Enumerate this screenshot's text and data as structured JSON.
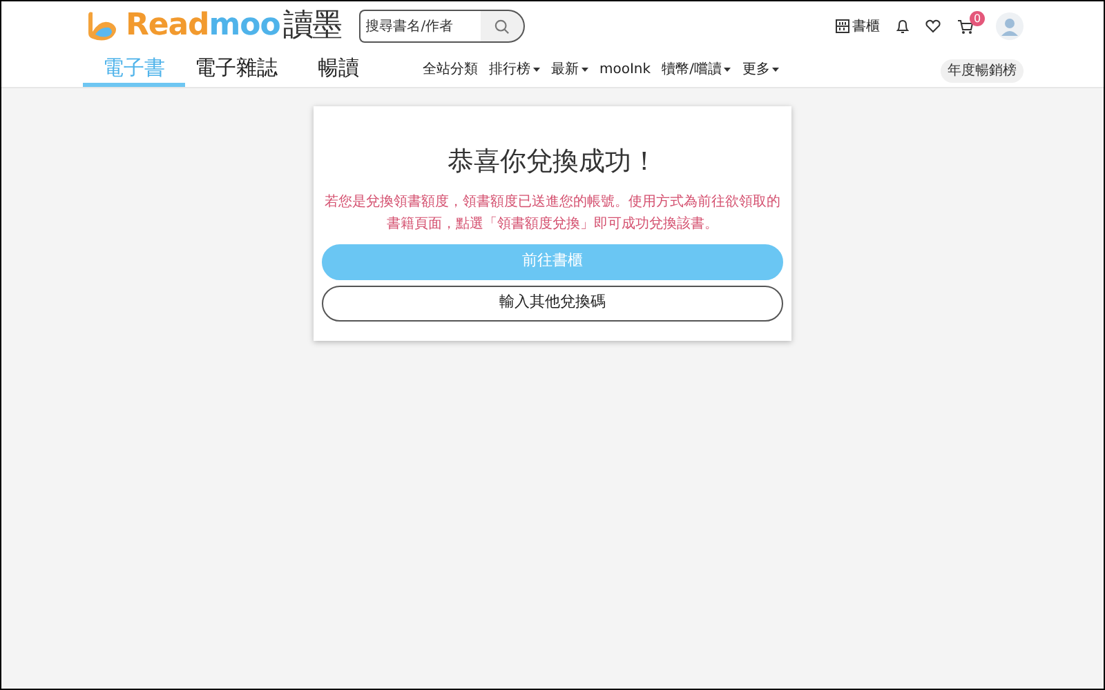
{
  "header": {
    "logo": {
      "part_1": "Read",
      "part_2": "moo",
      "chinese": "讀墨"
    },
    "search": {
      "placeholder": "搜尋書名/作者"
    },
    "bookshelf_label": "書櫃",
    "cart_count": "0"
  },
  "tabs": [
    {
      "label": "電子書",
      "selected": true
    },
    {
      "label": "電子雜誌",
      "selected": false
    },
    {
      "label": "暢讀",
      "selected": false
    }
  ],
  "nav_links": [
    {
      "label": "全站分類",
      "has_menu": false
    },
    {
      "label": "排行榜",
      "has_menu": true
    },
    {
      "label": "最新",
      "has_menu": true
    },
    {
      "label": "mooInk",
      "has_menu": false
    },
    {
      "label": "犢幣/嚐讀",
      "has_menu": true
    },
    {
      "label": "更多",
      "has_menu": true
    }
  ],
  "ranking_button": "年度暢銷榜",
  "card": {
    "title": "恭喜你兌換成功！",
    "message": "若您是兌換領書額度，領書額度已送進您的帳號。使用方式為前往欲領取的書籍頁面，點選「領書額度兌換」即可成功兌換該書。",
    "buttons": [
      {
        "label": "前往書櫃",
        "kind": "primary"
      },
      {
        "label": "輸入其他兌換碼",
        "kind": "outline"
      }
    ]
  }
}
